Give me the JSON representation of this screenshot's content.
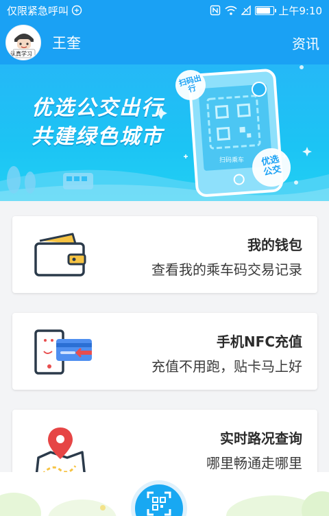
{
  "status_bar": {
    "carrier": "仅限紧急呼叫",
    "time": "上午9:10",
    "battery_level": 0.8
  },
  "header": {
    "username": "王奎",
    "news_label": "资讯",
    "avatar_caption": "认真学习"
  },
  "banner": {
    "line1": "优选公交出行",
    "line2": "共建绿色城市",
    "tag_scan": "扫码出行",
    "phone_caption": "扫码乘车",
    "badge": "优选公交"
  },
  "cards": [
    {
      "title": "我的钱包",
      "desc": "查看我的乘车码交易记录",
      "icon": "wallet-icon"
    },
    {
      "title": "手机NFC充值",
      "desc": "充值不用跑，贴卡马上好",
      "icon": "nfc-card-icon"
    },
    {
      "title": "实时路况查询",
      "desc": "哪里畅通走哪里",
      "icon": "map-pin-icon"
    }
  ],
  "bottom": {
    "scan_icon": "qr-scan-icon"
  },
  "colors": {
    "primary": "#1aa1f4",
    "wallet_yellow": "#f6c343",
    "pin_red": "#e64545"
  }
}
